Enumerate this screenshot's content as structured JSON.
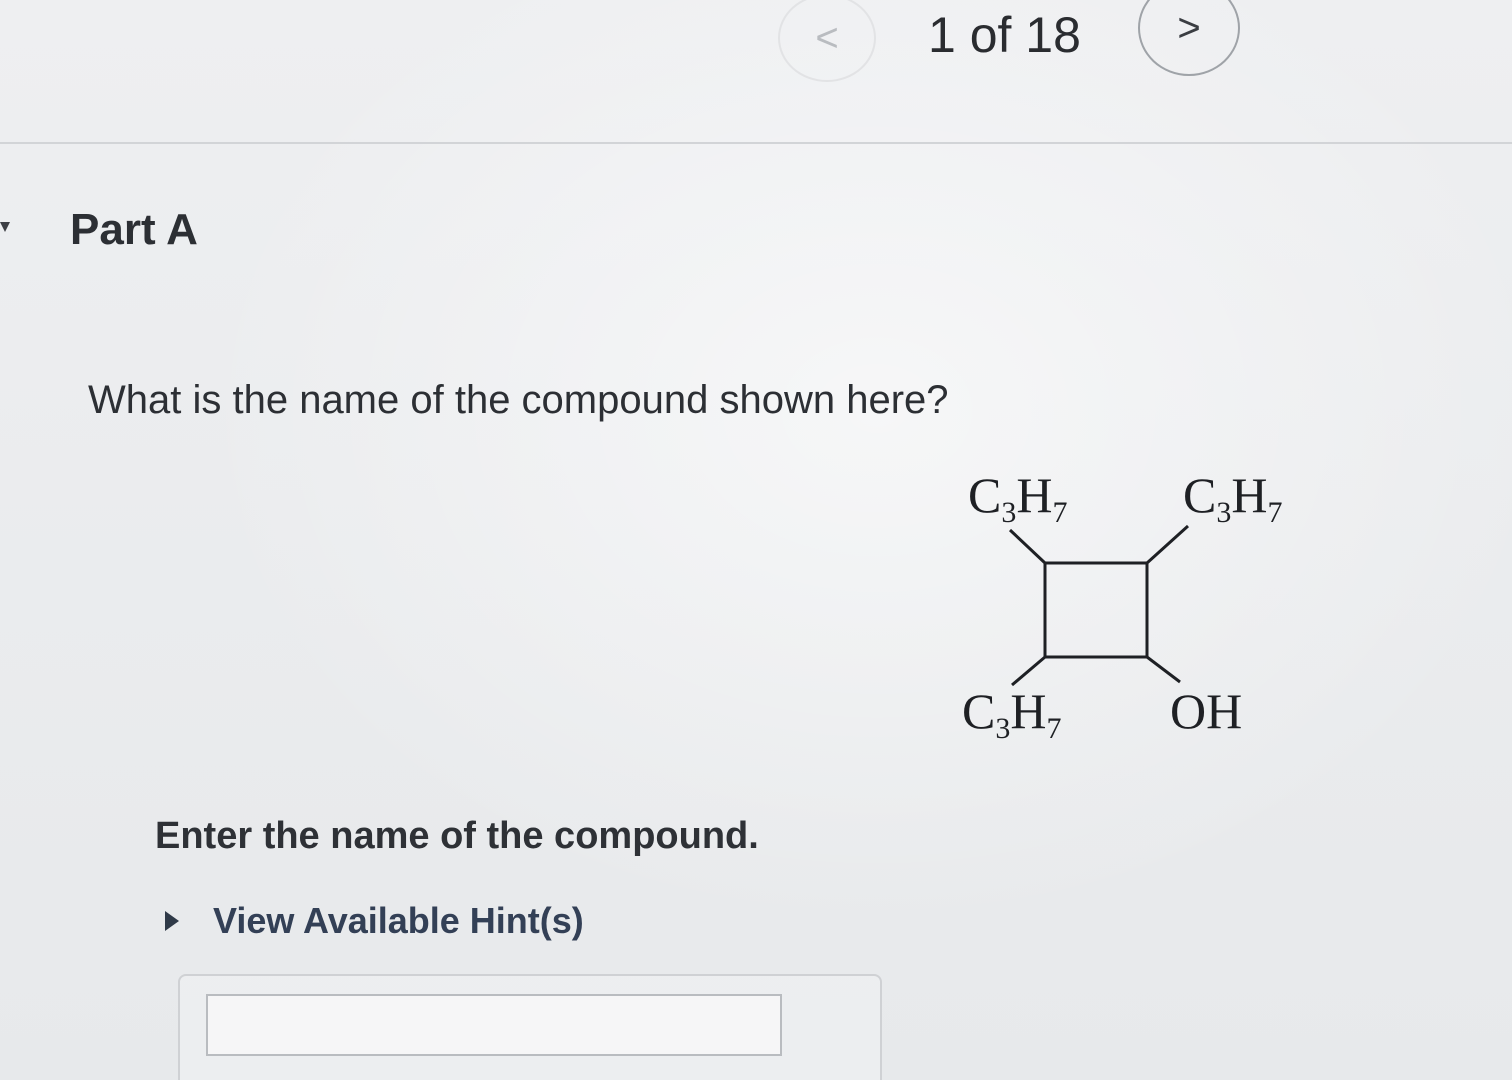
{
  "pager": {
    "prev_icon": "chevron-left-icon",
    "next_icon": "chevron-right-icon",
    "prev_glyph": "<",
    "next_glyph": ">",
    "position_text": "1 of 18"
  },
  "part": {
    "title": "Part A"
  },
  "question": {
    "text": "What is the name of the compound shown here?"
  },
  "structure": {
    "top_left": {
      "main": "C",
      "sub1": "3",
      "mid": "H",
      "sub2": "7"
    },
    "top_right": {
      "main": "C",
      "sub1": "3",
      "mid": "H",
      "sub2": "7"
    },
    "bottom_left": {
      "main": "C",
      "sub1": "3",
      "mid": "H",
      "sub2": "7"
    },
    "bottom_right": {
      "main": "OH"
    }
  },
  "answer": {
    "instruction": "Enter the name of the compound.",
    "hint_label": "View Available Hint(s)",
    "input_value": ""
  }
}
